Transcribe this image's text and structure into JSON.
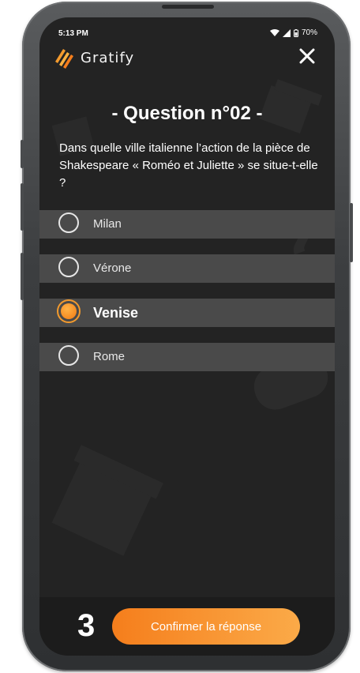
{
  "status_bar": {
    "time": "5:13 PM",
    "battery": "70%",
    "icons": [
      "wifi-icon",
      "signal-icon",
      "battery-icon"
    ]
  },
  "header": {
    "app_name": "Gratify",
    "logo_icon": "claw-logo-icon",
    "close_icon": "close-icon"
  },
  "question": {
    "title": "- Question n°02 -",
    "text": "Dans quelle ville italienne l’action de la pièce de Shakespeare « Roméo et Juliette » se situe-t-elle ?"
  },
  "answers": [
    {
      "label": "Milan",
      "selected": false
    },
    {
      "label": "Vérone",
      "selected": false
    },
    {
      "label": "Venise",
      "selected": true
    },
    {
      "label": "Rome",
      "selected": false
    }
  ],
  "footer": {
    "timer": "3",
    "confirm_label": "Confirmer la réponse"
  },
  "colors": {
    "accent": "#f39a2d",
    "background": "#232323",
    "answer_row": "#4a4a4a"
  }
}
